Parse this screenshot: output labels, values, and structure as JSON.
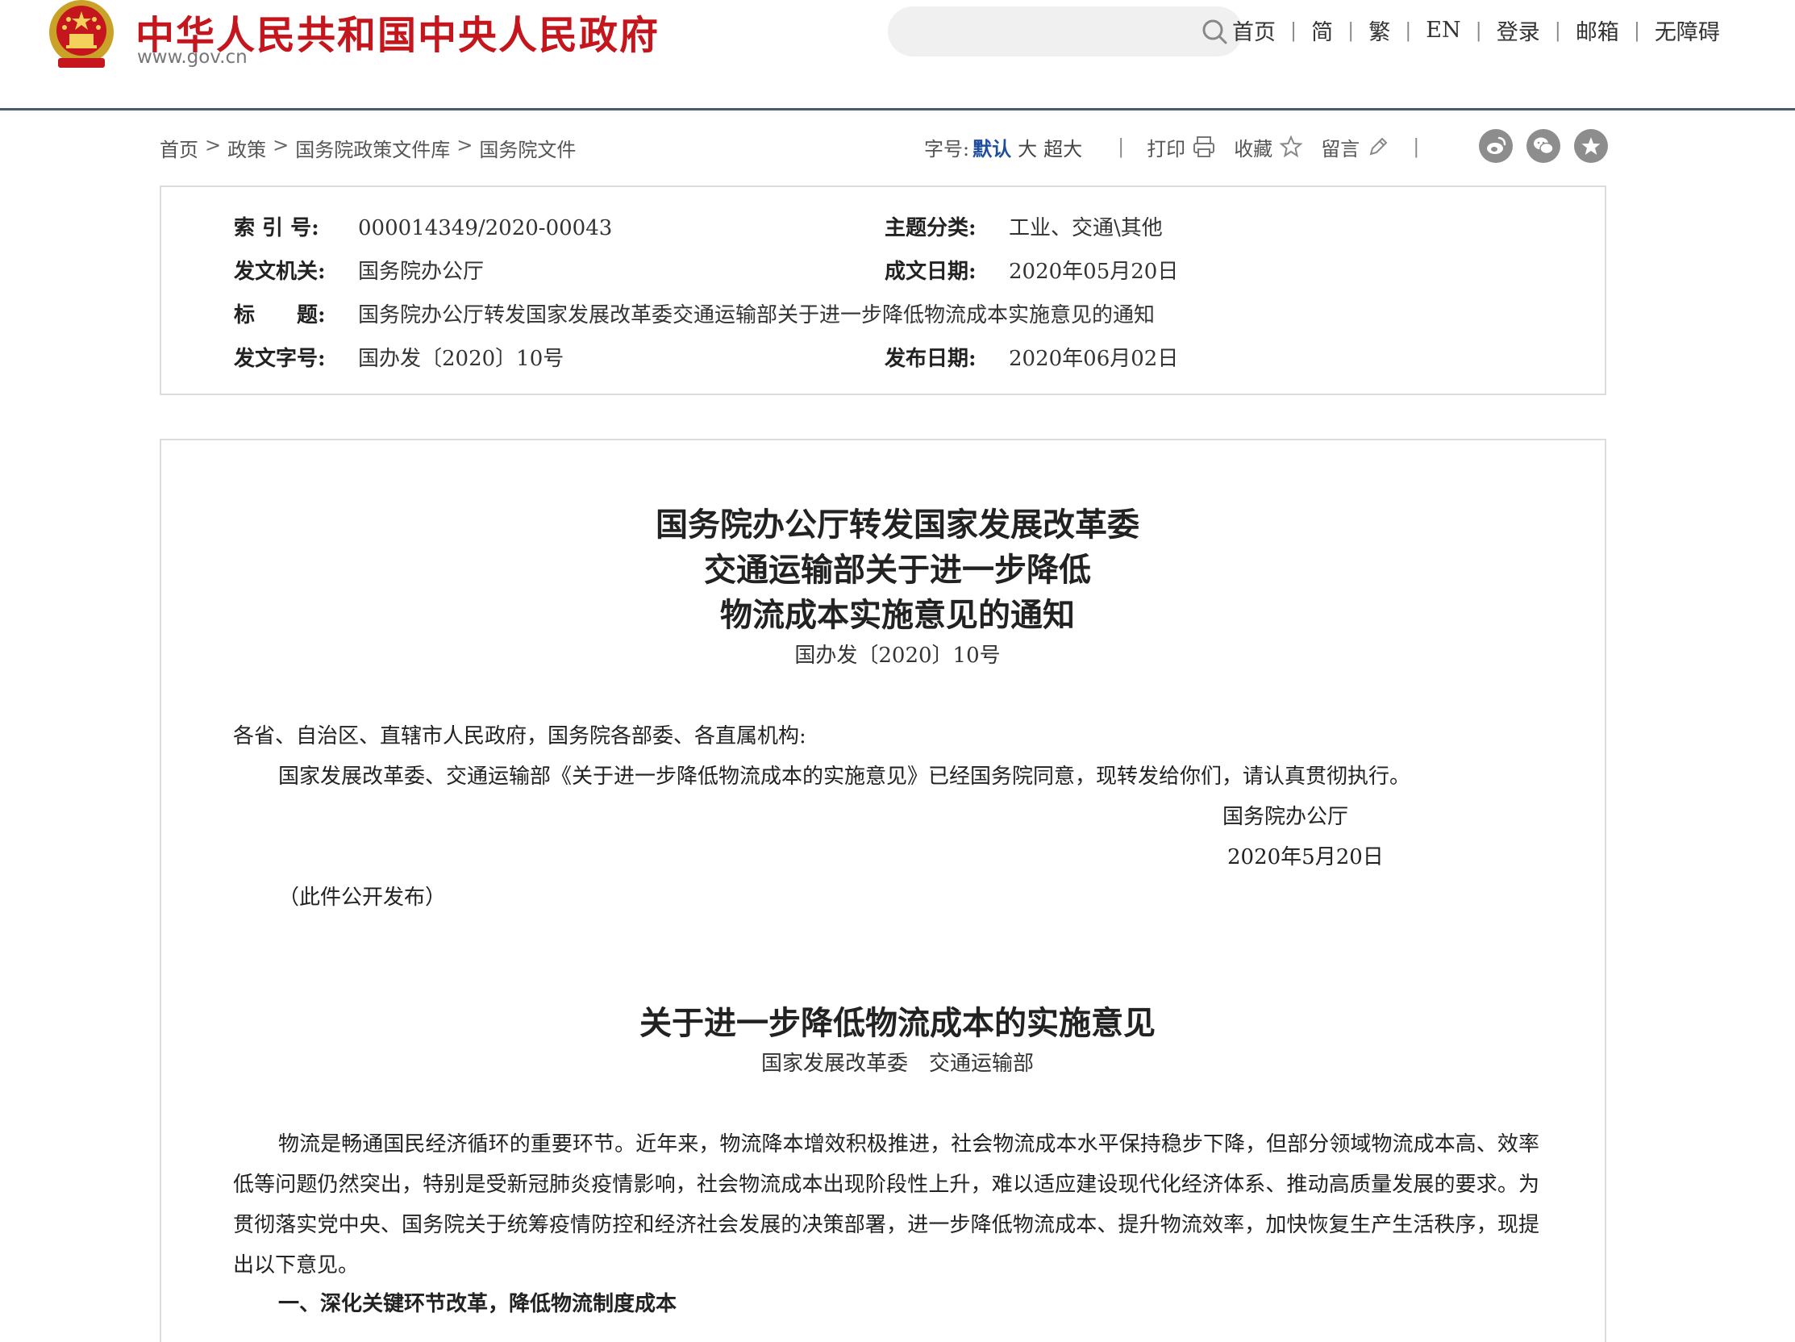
{
  "header": {
    "site_title": "中华人民共和国中央人民政府",
    "site_url": "www.gov.cn",
    "search_placeholder": "",
    "nav": [
      "首页",
      "简",
      "繁",
      "EN",
      "登录",
      "邮箱",
      "无障碍"
    ]
  },
  "breadcrumb": [
    "首页",
    "政策",
    "国务院政策文件库",
    "国务院文件"
  ],
  "toolbar": {
    "font_size_label": "字号:",
    "font_sizes": [
      "默认",
      "大",
      "超大"
    ],
    "print": "打印",
    "favorite": "收藏",
    "comment": "留言"
  },
  "share_icons": [
    "weibo-icon",
    "wechat-icon",
    "favorite-star-icon"
  ],
  "info": {
    "index_label": "索 引 号:",
    "index_value": "000014349/2020-00043",
    "topic_label": "主题分类:",
    "topic_value": "工业、交通\\其他",
    "issuer_label": "发文机关:",
    "issuer_value": "国务院办公厅",
    "written_label": "成文日期:",
    "written_value": "2020年05月20日",
    "title_label": "标　　题:",
    "title_value": "国务院办公厅转发国家发展改革委交通运输部关于进一步降低物流成本实施意见的通知",
    "docno_label": "发文字号:",
    "docno_value": "国办发〔2020〕10号",
    "published_label": "发布日期:",
    "published_value": "2020年06月02日"
  },
  "document": {
    "title_lines": [
      "国务院办公厅转发国家发展改革委",
      "交通运输部关于进一步降低",
      "物流成本实施意见的通知"
    ],
    "doc_number": "国办发〔2020〕10号",
    "addressee": "各省、自治区、直辖市人民政府，国务院各部委、各直属机构:",
    "notice": "国家发展改革委、交通运输部《关于进一步降低物流成本的实施意见》已经国务院同意，现转发给你们，请认真贯彻执行。",
    "signer": "国务院办公厅",
    "sign_date": "2020年5月20日",
    "public_note": "（此件公开发布）",
    "opinion_title": "关于进一步降低物流成本的实施意见",
    "opinion_authors": "国家发展改革委　交通运输部",
    "body_paragraph": "物流是畅通国民经济循环的重要环节。近年来，物流降本增效积极推进，社会物流成本水平保持稳步下降，但部分领域物流成本高、效率低等问题仍然突出，特别是受新冠肺炎疫情影响，社会物流成本出现阶段性上升，难以适应建设现代化经济体系、推动高质量发展的要求。为贯彻落实党中央、国务院关于统筹疫情防控和经济社会发展的决策部署，进一步降低物流成本、提升物流效率，加快恢复生产生活秩序，现提出以下意见。",
    "section_one": "一、深化关键环节改革，降低物流制度成本"
  },
  "colors": {
    "brand_red": "#c4161c",
    "header_line": "#4a5b6b",
    "link_blue": "#1f4e9c",
    "border": "#dcdcdc",
    "share_gray": "#8d8d8d"
  }
}
